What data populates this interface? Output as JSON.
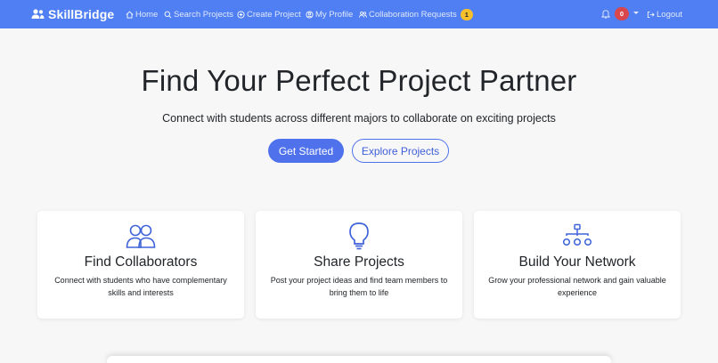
{
  "navbar": {
    "brand": "SkillBridge",
    "items": [
      {
        "label": "Home",
        "icon": "home-icon"
      },
      {
        "label": "Search Projects",
        "icon": "search-icon"
      },
      {
        "label": "Create Project",
        "icon": "plus-circle-icon"
      },
      {
        "label": "My Profile",
        "icon": "user-circle-icon"
      },
      {
        "label": "Collaboration Requests",
        "icon": "people-icon",
        "badge": "1"
      }
    ],
    "notifications_count": "0",
    "logout_label": "Logout"
  },
  "hero": {
    "title": "Find Your Perfect Project Partner",
    "subtitle": "Connect with students across different majors to collaborate on exciting projects",
    "primary_button": "Get Started",
    "secondary_button": "Explore Projects"
  },
  "features": [
    {
      "title": "Find Collaborators",
      "description": "Connect with students who have complementary skills and interests",
      "icon": "people-icon"
    },
    {
      "title": "Share Projects",
      "description": "Post your project ideas and find team members to bring them to life",
      "icon": "lightbulb-icon"
    },
    {
      "title": "Build Your Network",
      "description": "Grow your professional network and gain valuable experience",
      "icon": "network-icon"
    }
  ],
  "colors": {
    "navbar": "#4f7ff2",
    "primary": "#4f72ec",
    "badge_warning": "#f5c02b",
    "badge_danger": "#d9464b",
    "background": "#f7f7f8"
  }
}
